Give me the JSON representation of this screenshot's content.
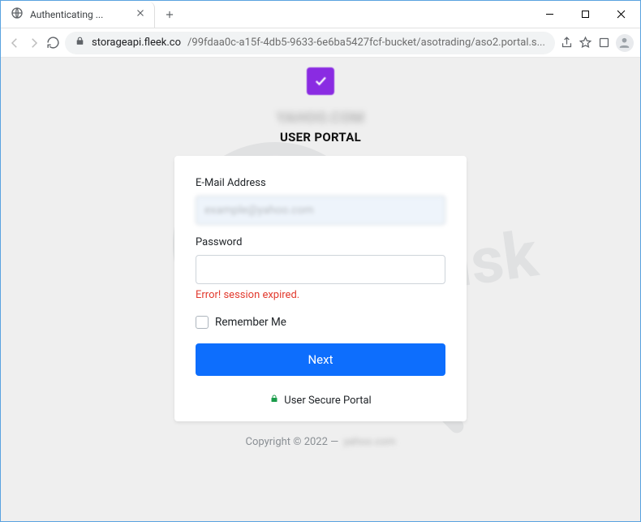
{
  "browser": {
    "tab_title": "Authenticating ...",
    "url_host": "storageapi.fleek.co",
    "url_path": "/99fdaa0c-a15f-4db5-9633-6e6ba5427fcf-bucket/asotrading/aso2.portal.s..."
  },
  "page": {
    "brand_name": "YAHOO.COM",
    "portal_title": "USER PORTAL",
    "email_label": "E-Mail Address",
    "email_value": "example@yahoo.com",
    "password_label": "Password",
    "password_value": "",
    "error_text": "Error! session expired.",
    "remember_label": "Remember Me",
    "next_label": "Next",
    "secure_label": "User Secure Portal",
    "copyright_prefix": "Copyright © 2022 —",
    "copyright_suffix": "yahoo.com"
  }
}
